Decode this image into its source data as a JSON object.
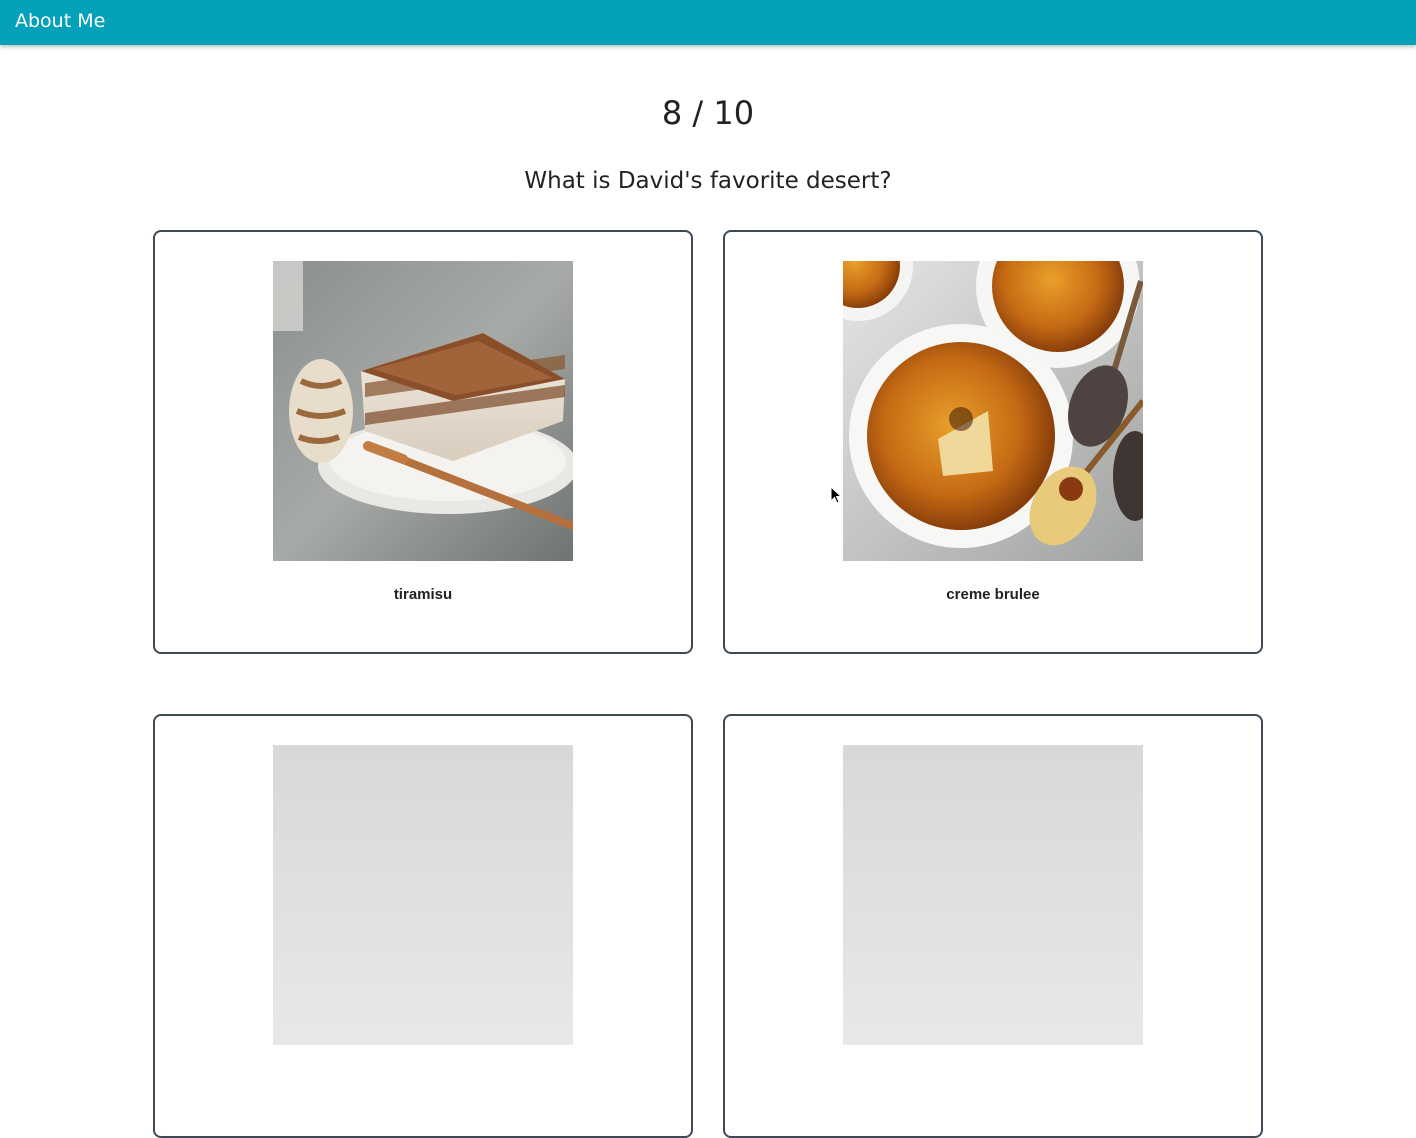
{
  "header": {
    "title": "About Me",
    "color": "#05a1bb"
  },
  "quiz": {
    "progress": "8 / 10",
    "current": 8,
    "total": 10,
    "question": "What is David's favorite desert?"
  },
  "options": [
    {
      "label": "tiramisu",
      "image": "tiramisu-photo"
    },
    {
      "label": "creme brulee",
      "image": "creme-brulee-photo"
    },
    {
      "label": "",
      "image": "option-3-photo"
    },
    {
      "label": "",
      "image": "option-4-photo"
    }
  ]
}
